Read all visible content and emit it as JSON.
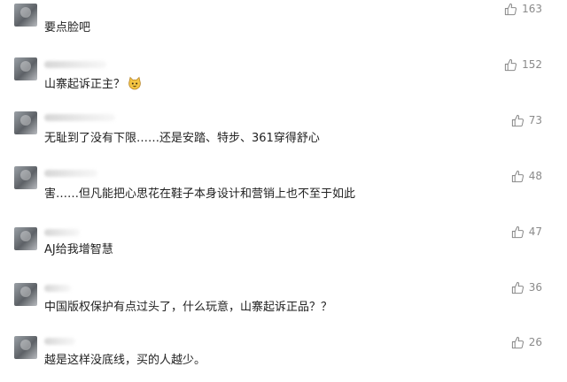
{
  "comments": [
    {
      "text": "要点脸吧",
      "likes": "163",
      "icon": "thumbs-up-icon"
    },
    {
      "text": "山寨起诉正主？",
      "likes": "152",
      "icon": "thumbs-up-icon",
      "emoji": "cat-emoji"
    },
    {
      "text": "无耻到了没有下限……还是安踏、特步、361穿得舒心",
      "likes": "73",
      "icon": "thumbs-up-icon"
    },
    {
      "text": "害……但凡能把心思花在鞋子本身设计和营销上也不至于如此",
      "likes": "48",
      "icon": "thumbs-up-icon"
    },
    {
      "text": "AJ给我增智慧",
      "likes": "47",
      "icon": "thumbs-up-icon"
    },
    {
      "text": "中国版权保护有点过头了，什么玩意，山寨起诉正品？？",
      "likes": "36",
      "icon": "thumbs-up-icon"
    },
    {
      "text": "越是这样没底线，买的人越少。",
      "likes": "26",
      "icon": "thumbs-up-icon"
    }
  ]
}
